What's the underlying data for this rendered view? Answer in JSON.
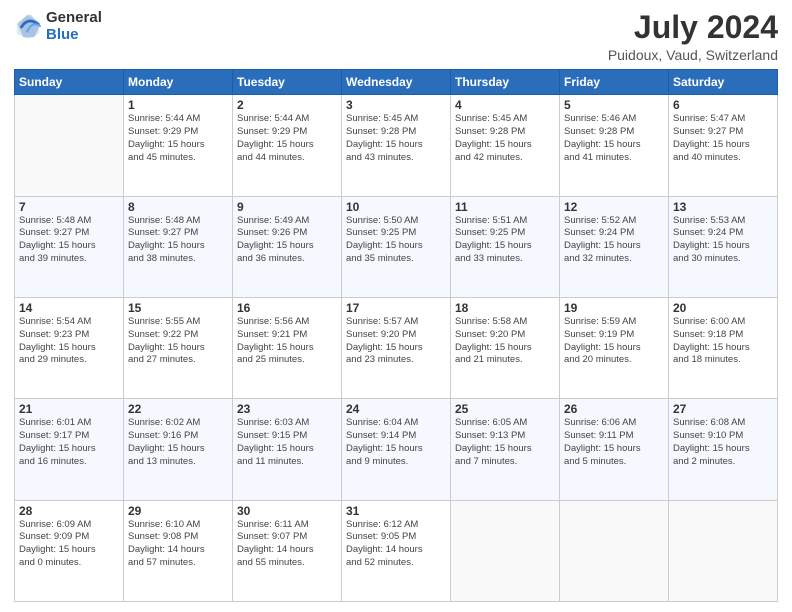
{
  "logo": {
    "general": "General",
    "blue": "Blue"
  },
  "title": "July 2024",
  "subtitle": "Puidoux, Vaud, Switzerland",
  "weekdays": [
    "Sunday",
    "Monday",
    "Tuesday",
    "Wednesday",
    "Thursday",
    "Friday",
    "Saturday"
  ],
  "weeks": [
    [
      {
        "day": "",
        "info": ""
      },
      {
        "day": "1",
        "info": "Sunrise: 5:44 AM\nSunset: 9:29 PM\nDaylight: 15 hours\nand 45 minutes."
      },
      {
        "day": "2",
        "info": "Sunrise: 5:44 AM\nSunset: 9:29 PM\nDaylight: 15 hours\nand 44 minutes."
      },
      {
        "day": "3",
        "info": "Sunrise: 5:45 AM\nSunset: 9:28 PM\nDaylight: 15 hours\nand 43 minutes."
      },
      {
        "day": "4",
        "info": "Sunrise: 5:45 AM\nSunset: 9:28 PM\nDaylight: 15 hours\nand 42 minutes."
      },
      {
        "day": "5",
        "info": "Sunrise: 5:46 AM\nSunset: 9:28 PM\nDaylight: 15 hours\nand 41 minutes."
      },
      {
        "day": "6",
        "info": "Sunrise: 5:47 AM\nSunset: 9:27 PM\nDaylight: 15 hours\nand 40 minutes."
      }
    ],
    [
      {
        "day": "7",
        "info": "Sunrise: 5:48 AM\nSunset: 9:27 PM\nDaylight: 15 hours\nand 39 minutes."
      },
      {
        "day": "8",
        "info": "Sunrise: 5:48 AM\nSunset: 9:27 PM\nDaylight: 15 hours\nand 38 minutes."
      },
      {
        "day": "9",
        "info": "Sunrise: 5:49 AM\nSunset: 9:26 PM\nDaylight: 15 hours\nand 36 minutes."
      },
      {
        "day": "10",
        "info": "Sunrise: 5:50 AM\nSunset: 9:25 PM\nDaylight: 15 hours\nand 35 minutes."
      },
      {
        "day": "11",
        "info": "Sunrise: 5:51 AM\nSunset: 9:25 PM\nDaylight: 15 hours\nand 33 minutes."
      },
      {
        "day": "12",
        "info": "Sunrise: 5:52 AM\nSunset: 9:24 PM\nDaylight: 15 hours\nand 32 minutes."
      },
      {
        "day": "13",
        "info": "Sunrise: 5:53 AM\nSunset: 9:24 PM\nDaylight: 15 hours\nand 30 minutes."
      }
    ],
    [
      {
        "day": "14",
        "info": "Sunrise: 5:54 AM\nSunset: 9:23 PM\nDaylight: 15 hours\nand 29 minutes."
      },
      {
        "day": "15",
        "info": "Sunrise: 5:55 AM\nSunset: 9:22 PM\nDaylight: 15 hours\nand 27 minutes."
      },
      {
        "day": "16",
        "info": "Sunrise: 5:56 AM\nSunset: 9:21 PM\nDaylight: 15 hours\nand 25 minutes."
      },
      {
        "day": "17",
        "info": "Sunrise: 5:57 AM\nSunset: 9:20 PM\nDaylight: 15 hours\nand 23 minutes."
      },
      {
        "day": "18",
        "info": "Sunrise: 5:58 AM\nSunset: 9:20 PM\nDaylight: 15 hours\nand 21 minutes."
      },
      {
        "day": "19",
        "info": "Sunrise: 5:59 AM\nSunset: 9:19 PM\nDaylight: 15 hours\nand 20 minutes."
      },
      {
        "day": "20",
        "info": "Sunrise: 6:00 AM\nSunset: 9:18 PM\nDaylight: 15 hours\nand 18 minutes."
      }
    ],
    [
      {
        "day": "21",
        "info": "Sunrise: 6:01 AM\nSunset: 9:17 PM\nDaylight: 15 hours\nand 16 minutes."
      },
      {
        "day": "22",
        "info": "Sunrise: 6:02 AM\nSunset: 9:16 PM\nDaylight: 15 hours\nand 13 minutes."
      },
      {
        "day": "23",
        "info": "Sunrise: 6:03 AM\nSunset: 9:15 PM\nDaylight: 15 hours\nand 11 minutes."
      },
      {
        "day": "24",
        "info": "Sunrise: 6:04 AM\nSunset: 9:14 PM\nDaylight: 15 hours\nand 9 minutes."
      },
      {
        "day": "25",
        "info": "Sunrise: 6:05 AM\nSunset: 9:13 PM\nDaylight: 15 hours\nand 7 minutes."
      },
      {
        "day": "26",
        "info": "Sunrise: 6:06 AM\nSunset: 9:11 PM\nDaylight: 15 hours\nand 5 minutes."
      },
      {
        "day": "27",
        "info": "Sunrise: 6:08 AM\nSunset: 9:10 PM\nDaylight: 15 hours\nand 2 minutes."
      }
    ],
    [
      {
        "day": "28",
        "info": "Sunrise: 6:09 AM\nSunset: 9:09 PM\nDaylight: 15 hours\nand 0 minutes."
      },
      {
        "day": "29",
        "info": "Sunrise: 6:10 AM\nSunset: 9:08 PM\nDaylight: 14 hours\nand 57 minutes."
      },
      {
        "day": "30",
        "info": "Sunrise: 6:11 AM\nSunset: 9:07 PM\nDaylight: 14 hours\nand 55 minutes."
      },
      {
        "day": "31",
        "info": "Sunrise: 6:12 AM\nSunset: 9:05 PM\nDaylight: 14 hours\nand 52 minutes."
      },
      {
        "day": "",
        "info": ""
      },
      {
        "day": "",
        "info": ""
      },
      {
        "day": "",
        "info": ""
      }
    ]
  ]
}
